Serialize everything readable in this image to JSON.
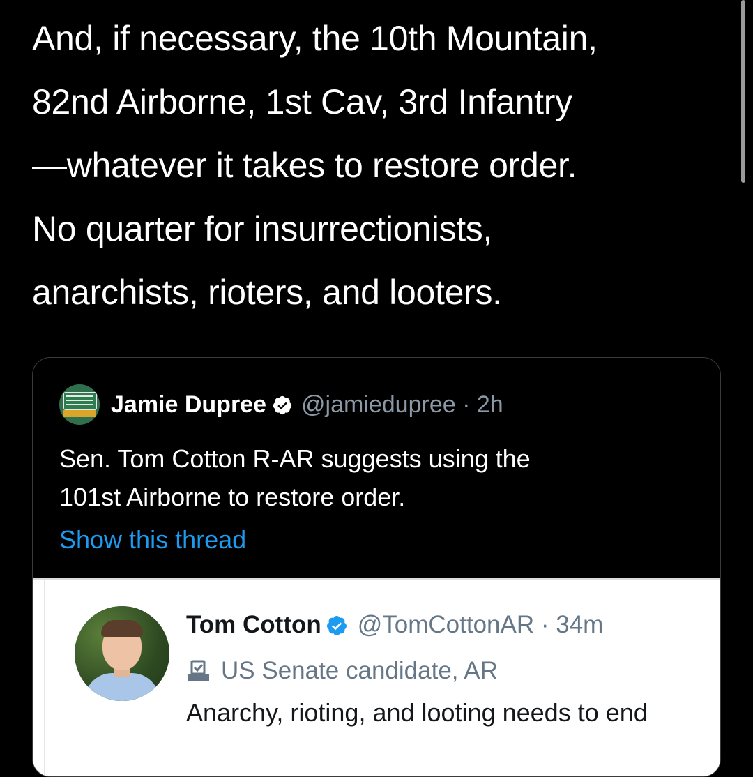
{
  "tweet": {
    "lines": [
      "And, if necessary, the 10th Mountain,",
      "82nd Airborne, 1st Cav, 3rd Infantry",
      "—whatever it takes to restore order.",
      "No quarter for insurrectionists,",
      "anarchists, rioters, and looters."
    ]
  },
  "quote": {
    "avatar_icon": "road-sign-avatar",
    "name": "Jamie Dupree",
    "verified_icon": "verified-badge-icon",
    "handle_time": "@jamiedupree · 2h",
    "body_lines": [
      "Sen. Tom Cotton R-AR suggests using the",
      "101st Airborne to restore order."
    ],
    "show_thread": "Show this thread"
  },
  "embedded": {
    "name": "Tom Cotton",
    "verified_icon": "verified-badge-icon",
    "handle_time": "@TomCottonAR · 34m",
    "label_icon": "ballot-box-icon",
    "label": "US Senate candidate, AR",
    "text": "Anarchy, rioting, and looting needs to end"
  },
  "colors": {
    "background": "#000000",
    "link": "#1d9bf0",
    "muted": "#8b98a5",
    "verified_blue": "#1d9bf0"
  }
}
